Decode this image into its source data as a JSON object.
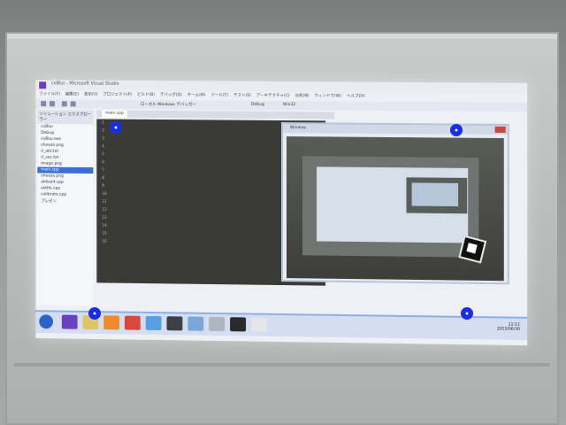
{
  "vs": {
    "title": "cvBlur - Microsoft Visual Studio",
    "menu": [
      "ファイル(F)",
      "編集(E)",
      "表示(V)",
      "プロジェクト(P)",
      "ビルド(B)",
      "デバッグ(D)",
      "チーム(M)",
      "ツール(T)",
      "テスト(S)",
      "アーキテクチャ(C)",
      "分析(N)",
      "ウィンドウ(W)",
      "ヘルプ(H)"
    ],
    "toolbar_text": "ローカル Windows デバッガー",
    "config": "Debug",
    "platform": "Win32"
  },
  "solution": {
    "header": "ソリューション エクスプローラー",
    "items": [
      "cvBlur",
      "Debug",
      "cvBlur.exe",
      "cheeze.png",
      "rl_akt.txt",
      "rl_sec.txt",
      "image.png",
      "main.cpp",
      "cheeze.png",
      "akbsalt.cpp",
      "settle.cpp",
      "calibrate.cpp",
      "プレゼン"
    ]
  },
  "editor": {
    "tab": "main.cpp",
    "lines": [
      "1",
      "2",
      "3",
      "4",
      "5",
      "6",
      "7",
      "8",
      "9",
      "10",
      "11",
      "12",
      "13",
      "14",
      "15",
      "16"
    ]
  },
  "popup": {
    "title": "Window"
  },
  "taskbar": {
    "apps": [
      "vs",
      "folder",
      "vlc",
      "chrome",
      "ie",
      "cam",
      "pic",
      "settings",
      "cmd",
      "paint"
    ],
    "time": "12:11",
    "date": "2015/06/30"
  }
}
